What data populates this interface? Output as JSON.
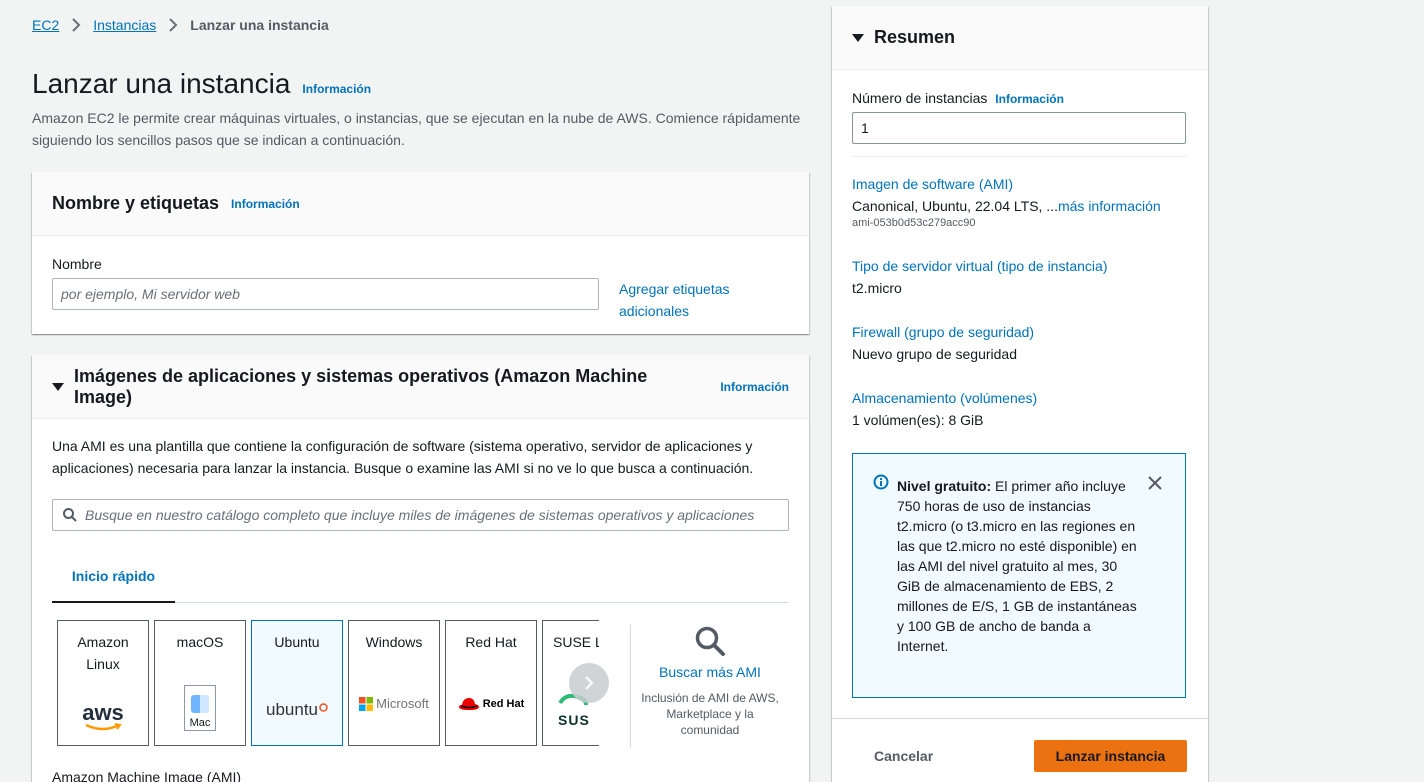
{
  "breadcrumb": {
    "ec2": "EC2",
    "instances": "Instancias",
    "current": "Lanzar una instancia"
  },
  "page": {
    "title": "Lanzar una instancia",
    "info": "Información",
    "description": "Amazon EC2 le permite crear máquinas virtuales, o instancias, que se ejecutan en la nube de AWS. Comience rápidamente siguiendo los sencillos pasos que se indican a continuación."
  },
  "name_section": {
    "title": "Nombre y etiquetas",
    "info": "Información",
    "name_label": "Nombre",
    "name_placeholder": "por ejemplo, Mi servidor web",
    "add_tags": "Agregar etiquetas adicionales"
  },
  "ami_section": {
    "title": "Imágenes de aplicaciones y sistemas operativos (Amazon Machine Image)",
    "info": "Información",
    "description": "Una AMI es una plantilla que contiene la configuración de software (sistema operativo, servidor de aplicaciones y aplicaciones) necesaria para lanzar la instancia. Busque o examine las AMI si no ve lo que busca a continuación.",
    "search_placeholder": "Busque en nuestro catálogo completo que incluye miles de imágenes de sistemas operativos y aplicaciones",
    "tab_quickstart": "Inicio rápido",
    "os_cards": [
      {
        "name": "Amazon Linux",
        "logo_text": "aws"
      },
      {
        "name": "macOS",
        "logo_text": "Mac"
      },
      {
        "name": "Ubuntu",
        "logo_text": "ubuntu"
      },
      {
        "name": "Windows",
        "logo_text": "Microsoft"
      },
      {
        "name": "Red Hat",
        "logo_text": "Red Hat"
      },
      {
        "name": "SUSE Li",
        "logo_text": "SUS"
      }
    ],
    "browse_more": "Buscar más AMI",
    "browse_desc": "Inclusión de AMI de AWS, Marketplace y la comunidad",
    "ami_label": "Amazon Machine Image (AMI)"
  },
  "summary": {
    "title": "Resumen",
    "instances_label": "Número de instancias",
    "info": "Información",
    "instances_value": "1",
    "ami_title": "Imagen de software (AMI)",
    "ami_value": "Canonical, Ubuntu, 22.04 LTS, ...",
    "ami_more": "más información",
    "ami_id": "ami-053b0d53c279acc90",
    "type_title": "Tipo de servidor virtual (tipo de instancia)",
    "type_value": "t2.micro",
    "firewall_title": "Firewall (grupo de seguridad)",
    "firewall_value": "Nuevo grupo de seguridad",
    "storage_title": "Almacenamiento (volúmenes)",
    "storage_value": "1 volúmen(es): 8 GiB",
    "free_tier_bold": "Nivel gratuito:",
    "free_tier_text": " El primer año incluye 750 horas de uso de instancias t2.micro (o t3.micro en las regiones en las que t2.micro no esté disponible) en las AMI del nivel gratuito al mes, 30 GiB de almacenamiento de EBS, 2 millones de E/S, 1 GB de instantáneas y 100 GB de ancho de banda a Internet.",
    "cancel": "Cancelar",
    "launch": "Lanzar instancia"
  },
  "colors": {
    "accent": "#0073bb",
    "primary_button": "#ec7211"
  }
}
